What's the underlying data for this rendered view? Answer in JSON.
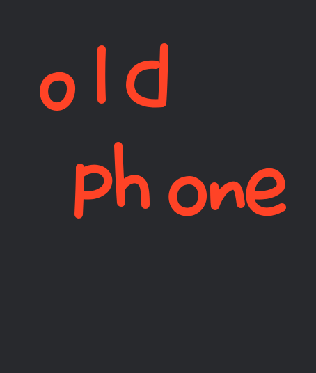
{
  "note": {
    "lines": [
      "old",
      "phone"
    ],
    "ink_color": "#ff4326",
    "background_color": "#28292d"
  }
}
